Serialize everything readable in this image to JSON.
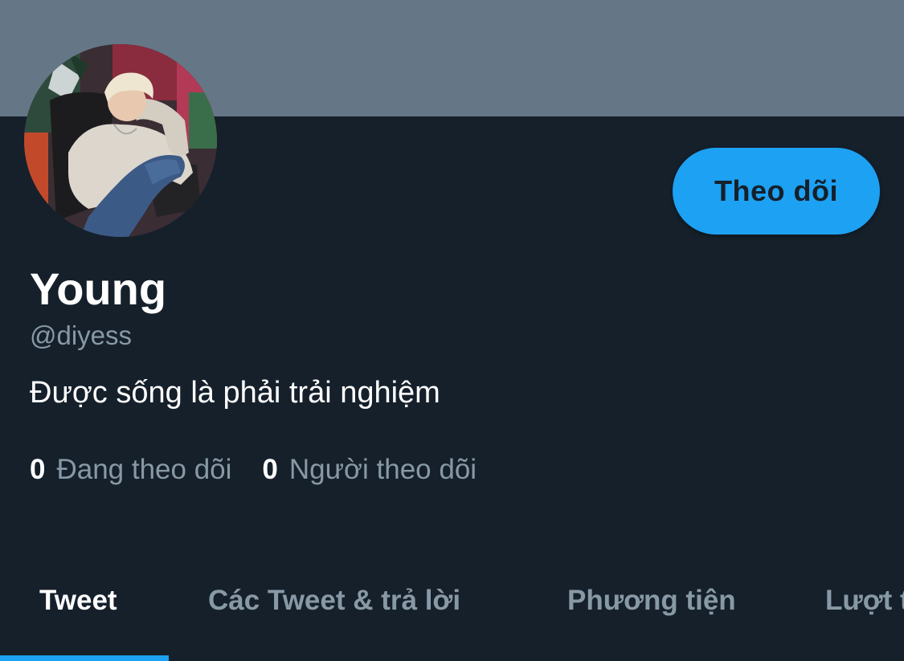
{
  "profile": {
    "display_name": "Young",
    "handle": "@diyess",
    "bio": "Được sống là phải trải nghiệm"
  },
  "actions": {
    "follow_label": "Theo dõi"
  },
  "stats": {
    "following_count": "0",
    "following_label": "Đang theo dõi",
    "followers_count": "0",
    "followers_label": "Người theo dõi"
  },
  "tabs": [
    {
      "label": "Tweet",
      "active": true
    },
    {
      "label": "Các Tweet & trả lời",
      "active": false
    },
    {
      "label": "Phương tiện",
      "active": false
    },
    {
      "label": "Lượt thích",
      "active": false
    }
  ],
  "colors": {
    "background": "#15202b",
    "banner": "#657786",
    "accent": "#1da1f2",
    "secondary_text": "#8899a6"
  }
}
